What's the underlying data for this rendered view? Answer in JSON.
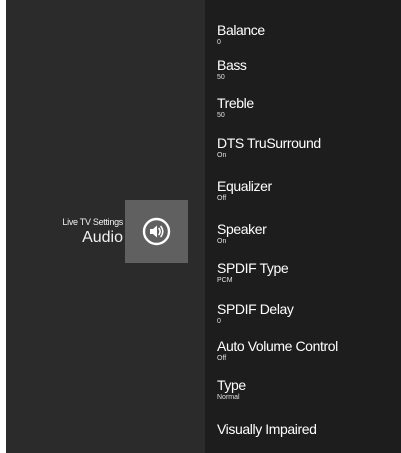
{
  "header": {
    "subtitle": "Live TV Settings",
    "title": "Audio",
    "icon": "speaker-volume-icon"
  },
  "colors": {
    "left_pane": "#2b2b2b",
    "right_pane": "#1d1d1d",
    "icon_tile": "#606060",
    "text": "#ffffff"
  },
  "menu": {
    "items": [
      {
        "label": "Balance",
        "value": "0"
      },
      {
        "label": "Bass",
        "value": "50"
      },
      {
        "label": "Treble",
        "value": "50"
      },
      {
        "label": "DTS TruSurround",
        "value": "On"
      },
      {
        "label": "Equalizer",
        "value": "Off"
      },
      {
        "label": "Speaker",
        "value": "On"
      },
      {
        "label": "SPDIF Type",
        "value": "PCM"
      },
      {
        "label": "SPDIF Delay",
        "value": "0"
      },
      {
        "label": "Auto Volume Control",
        "value": "Off"
      },
      {
        "label": "Type",
        "value": "Normal"
      },
      {
        "label": "Visually Impaired",
        "value": ""
      }
    ]
  }
}
